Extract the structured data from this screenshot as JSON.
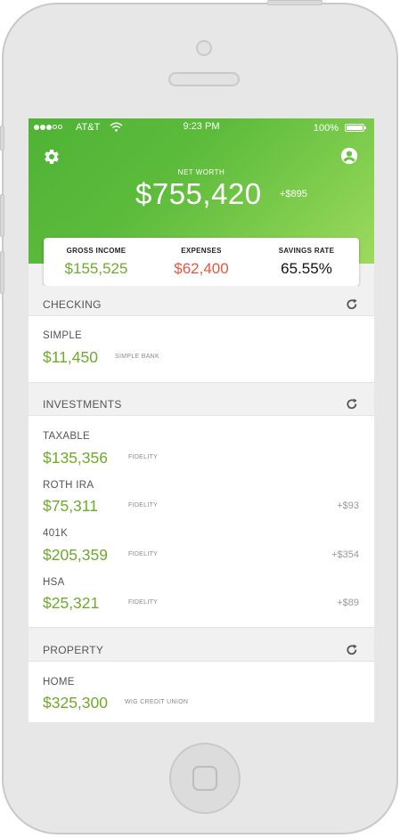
{
  "status_bar": {
    "carrier": "AT&T",
    "time": "9:23 PM",
    "battery": "100%"
  },
  "header": {
    "net_worth_label": "NET WORTH",
    "net_worth_value": "$755,420",
    "net_worth_change": "+$895"
  },
  "summary": [
    {
      "label": "GROSS INCOME",
      "value": "$155,525",
      "color": "#6eab2c"
    },
    {
      "label": "EXPENSES",
      "value": "$62,400",
      "color": "#e8573f"
    },
    {
      "label": "SAVINGS RATE",
      "value": "65.55%",
      "color": "#111111"
    }
  ],
  "sections": {
    "checking": {
      "title": "CHECKING",
      "accounts": [
        {
          "name": "SIMPLE",
          "value": "$11,450",
          "institution": "SIMPLE BANK",
          "change": ""
        }
      ]
    },
    "investments": {
      "title": "INVESTMENTS",
      "accounts": [
        {
          "name": "TAXABLE",
          "value": "$135,356",
          "institution": "FIDELITY",
          "change": ""
        },
        {
          "name": "ROTH IRA",
          "value": "$75,311",
          "institution": "FIDELITY",
          "change": "+$93"
        },
        {
          "name": "401K",
          "value": "$205,359",
          "institution": "FIDELITY",
          "change": "+$354"
        },
        {
          "name": "HSA",
          "value": "$25,321",
          "institution": "FIDELITY",
          "change": "+$89"
        }
      ]
    },
    "property": {
      "title": "PROPERTY",
      "accounts": [
        {
          "name": "HOME",
          "value": "$325,300",
          "institution": "WIG CREDIT UNION",
          "change": ""
        }
      ]
    }
  },
  "icons": {
    "settings": "gear-icon",
    "profile": "user-icon",
    "refresh": "refresh-icon",
    "wifi": "wifi-icon",
    "battery": "battery-icon"
  },
  "colors": {
    "brand_green": "#5cbb3b",
    "value_green": "#6eab2c",
    "expense_red": "#e8573f"
  }
}
